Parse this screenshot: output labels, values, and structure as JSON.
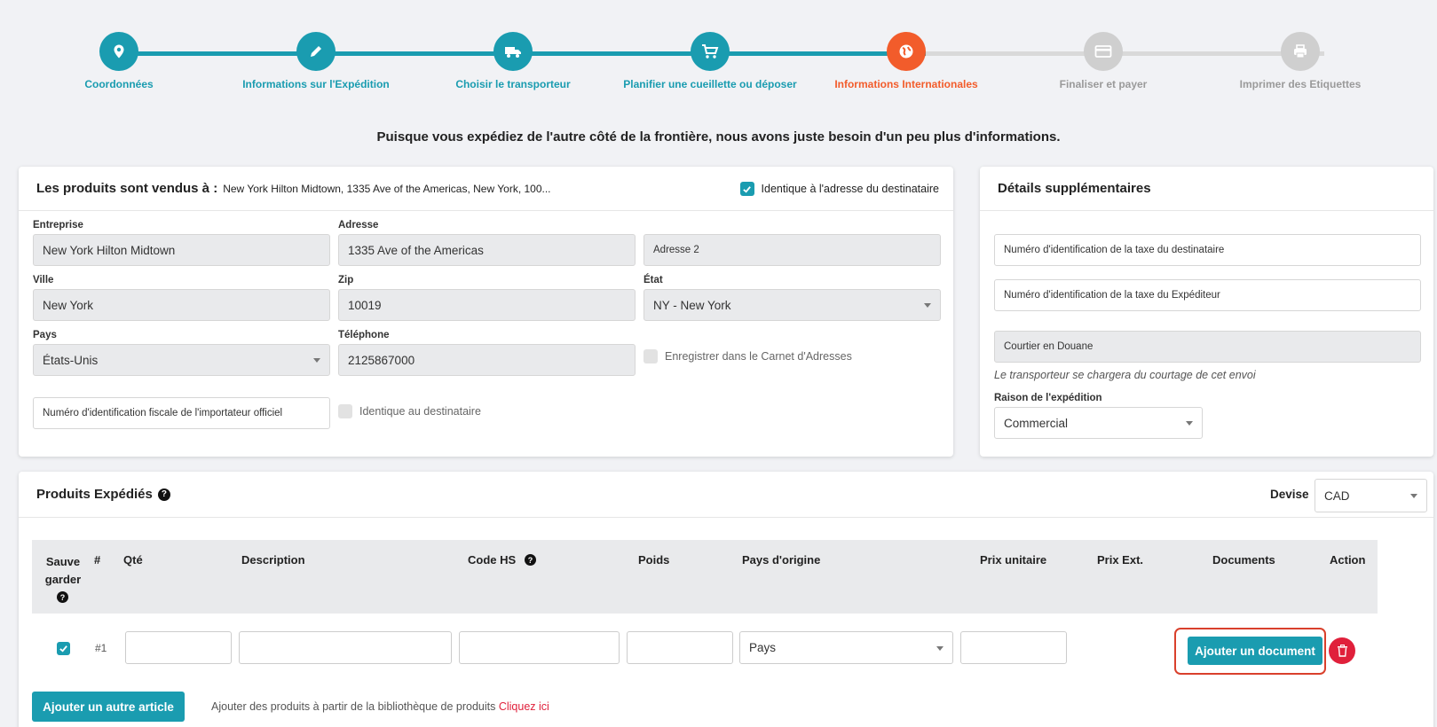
{
  "colors": {
    "teal": "#1a9cb0",
    "orange": "#f25c2b",
    "inactive": "#cfcfcf",
    "inactive_text": "#9a9a9a",
    "red": "#e0203b"
  },
  "steps": [
    {
      "label": "Coordonnées",
      "icon": "map-pin-icon",
      "state": "done"
    },
    {
      "label": "Informations sur l'Expédition",
      "icon": "pencil-icon",
      "state": "done"
    },
    {
      "label": "Choisir le transporteur",
      "icon": "truck-icon",
      "state": "done"
    },
    {
      "label": "Planifier une cueillette ou déposer",
      "icon": "cart-icon",
      "state": "done"
    },
    {
      "label": "Informations Internationales",
      "icon": "globe-icon",
      "state": "active"
    },
    {
      "label": "Finaliser et payer",
      "icon": "credit-card-icon",
      "state": "pending"
    },
    {
      "label": "Imprimer des Etiquettes",
      "icon": "printer-icon",
      "state": "pending"
    }
  ],
  "intro": "Puisque vous expédiez de l'autre côté de la frontière, nous avons juste besoin d'un peu plus d'informations.",
  "sold_to": {
    "title": "Les produits sont vendus à :",
    "address_summary": "New York Hilton Midtown, 1335 Ave of the Americas, New York, 100...",
    "same_as_recipient_label": "Identique à l'adresse du destinataire",
    "company_label": "Entreprise",
    "company_value": "New York Hilton Midtown",
    "address_label": "Adresse",
    "address_value": "1335 Ave of the Americas",
    "address2_placeholder": "Adresse 2",
    "city_label": "Ville",
    "city_value": "New York",
    "zip_label": "Zip",
    "zip_value": "10019",
    "state_label": "État",
    "state_value": "NY - New York",
    "country_label": "Pays",
    "country_value": "États-Unis",
    "phone_label": "Téléphone",
    "phone_value": "2125867000",
    "save_address_book_label": "Enregistrer dans le Carnet d'Adresses",
    "importer_tax_id_placeholder": "Numéro d'identification fiscale de l'importateur officiel",
    "same_as_dest_label": "Identique au destinataire"
  },
  "details": {
    "title": "Détails supplémentaires",
    "recipient_tax_placeholder": "Numéro d'identification de la taxe du destinataire",
    "shipper_tax_placeholder": "Numéro d'identification de la taxe du Expéditeur",
    "broker_value": "Courtier en Douane",
    "broker_note": "Le transporteur se chargera du courtage de cet envoi",
    "reason_label": "Raison de l'expédition",
    "reason_value": "Commercial"
  },
  "products": {
    "title": "Produits Expédiés",
    "currency_label": "Devise",
    "currency_value": "CAD",
    "columns": {
      "save": "Sauvegarder",
      "num": "#",
      "qty": "Qté",
      "description": "Description",
      "hs": "Code HS",
      "weight": "Poids",
      "origin": "Pays d'origine",
      "unit_price": "Prix unitaire",
      "ext_price": "Prix Ext.",
      "documents": "Documents",
      "action": "Action"
    },
    "row": {
      "num": "#1",
      "origin_placeholder": "Pays"
    },
    "add_document": "Ajouter un document",
    "add_item": "Ajouter un autre article",
    "library_text": "Ajouter des produits à partir de la bibliothèque de produits",
    "library_link": "Cliquez ici"
  }
}
